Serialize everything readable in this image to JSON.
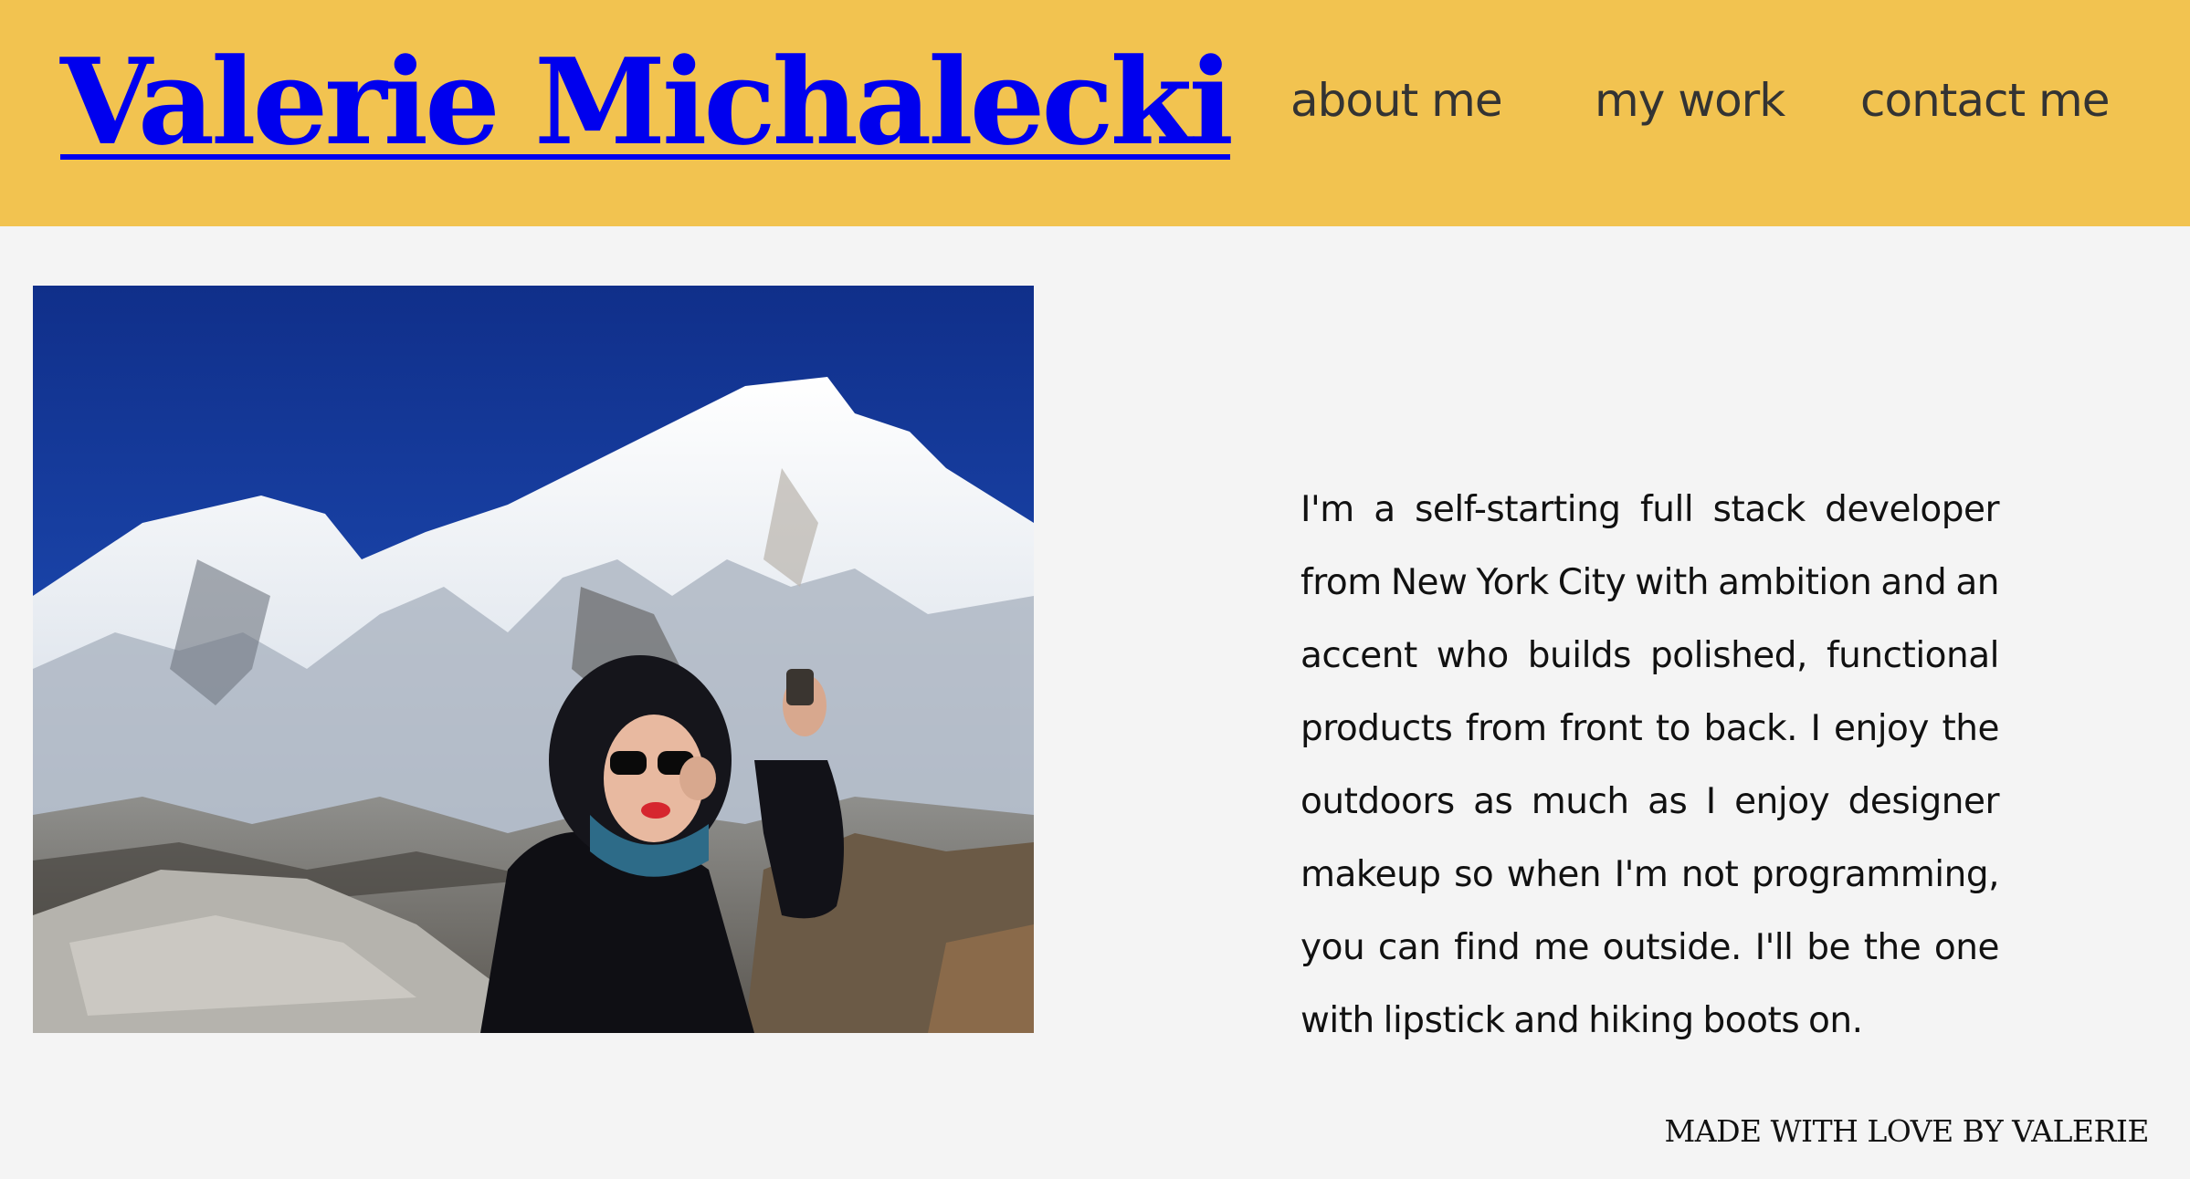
{
  "header": {
    "site_title": "Valerie Michalecki",
    "nav": [
      {
        "label": "about me"
      },
      {
        "label": "my work"
      },
      {
        "label": "contact me"
      }
    ]
  },
  "about": {
    "bio": "I'm a self-starting full stack developer from New York City with ambition and an accent who builds polished, functional products from front to back. I enjoy the outdoors as much as I enjoy designer makeup so when I'm not programming, you can find me outside. I'll be the one with lipstick and hiking boots on."
  },
  "footer": {
    "text": "MADE WITH LOVE BY VALERIE"
  },
  "colors": {
    "header_bg": "#f2c350",
    "page_bg": "#f4f4f4",
    "link": "#0000ee",
    "nav_text": "#333333"
  }
}
